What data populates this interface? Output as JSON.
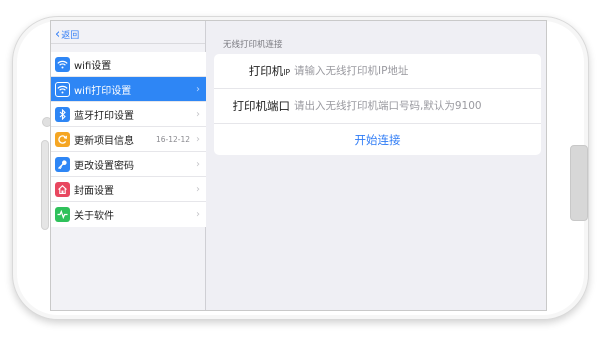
{
  "nav": {
    "back_label": "返回"
  },
  "sidebar": {
    "items": [
      {
        "label": "wifi设置",
        "icon": "wifi-icon",
        "color": "#2e86f5",
        "active": false
      },
      {
        "label": "wifi打印设置",
        "icon": "wifi-icon",
        "color": "#2e86f5",
        "active": true
      },
      {
        "label": "蓝牙打印设置",
        "icon": "bluetooth-icon",
        "color": "#2e86f5",
        "active": false
      },
      {
        "label": "更新项目信息",
        "icon": "refresh-icon",
        "color": "#f5a623",
        "active": false,
        "extra": "16-12-12"
      },
      {
        "label": "更改设置密码",
        "icon": "key-icon",
        "color": "#2e86f5",
        "active": false
      },
      {
        "label": "封面设置",
        "icon": "home-icon",
        "color": "#e8475f",
        "active": false
      },
      {
        "label": "关于软件",
        "icon": "pulse-icon",
        "color": "#2fc15b",
        "active": false
      }
    ]
  },
  "main": {
    "section_title": "无线打印机连接",
    "fields": {
      "ip": {
        "label_main": "打印机",
        "label_small": "IP",
        "value": "",
        "placeholder": "请输入无线打印机IP地址"
      },
      "port": {
        "label": "打印机端口",
        "value": "",
        "placeholder": "请出入无线打印机端口号码,默认为9100"
      }
    },
    "connect_label": "开始连接"
  },
  "colors": {
    "accent": "#2e86f5",
    "link": "#2f7cf6"
  }
}
